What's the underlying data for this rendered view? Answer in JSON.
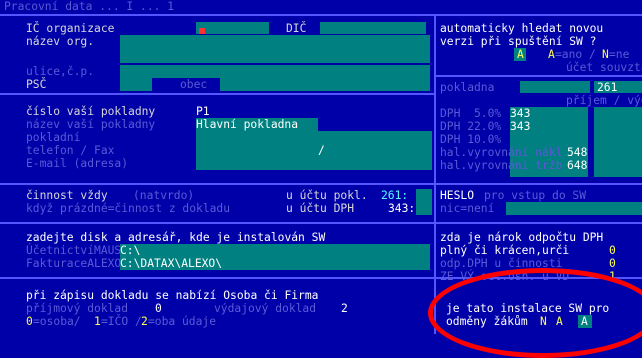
{
  "header": {
    "text": "Pracovní data ... I ... 1"
  },
  "org": {
    "ico_label": "IČ organizace",
    "dic_label": "DIČ",
    "name_label": "název org.",
    "street_label": "ulice,č.p.",
    "psc_label": "PSČ",
    "obec_label": "obec"
  },
  "register": {
    "number_label": "číslo vaší pokladny",
    "number_value": "P1",
    "name_label": "název vaší pokladny",
    "name_value": "Hlavní pokladna",
    "pokladni_label": "pokladní",
    "phone_label": "telefon / Fax",
    "phone_sep": "/",
    "email_label": "E-mail (adresa)"
  },
  "activity": {
    "line1_label": "činnost vždy",
    "line1_hint": "(natvrdo)",
    "line1_account_label": "u účtu pokl.",
    "line1_account_value": "261:",
    "line2_label": "když prázdné=činnost z dokladu",
    "line2_account_label": "u účtu DPH",
    "line2_account_value": "343:"
  },
  "disk": {
    "title": "zadejte disk a adresář, kde je instalován SW",
    "ucetnictvi_label": "ÚčetnictvíMAUS",
    "ucetnictvi_value": "C:\\",
    "fakturace_label": "FakturaceALEXO",
    "fakturace_value": "C:\\DATAX\\ALEXO\\"
  },
  "person": {
    "title": "při zápisu dokladu se nabízí Osoba či Firma",
    "prijmovy_label": "příjmový doklad",
    "prijmovy_value": "0",
    "vydajovy_label": "výdajový doklad",
    "vydajovy_value": "2",
    "legend_0": "0",
    "legend_0_text": "=osoba/",
    "legend_1": "1",
    "legend_1_text": "=IČO /",
    "legend_2": "2",
    "legend_2_text": "=oba údaje"
  },
  "right": {
    "auto_line1": "automaticky hledat novou",
    "auto_line2": "verzi při spuštění SW ?",
    "auto_value": "A",
    "auto_hint_key": "A",
    "auto_hint": "=ano /",
    "auto_hint_n": "N",
    "auto_hint_tail": "=ne",
    "ucet_header": "účet souvztaž",
    "prijem_header": "příjem / výdej",
    "pokladna_label": "pokladna",
    "pokladna_value": "261",
    "dph5_label": "DPH  5.0%",
    "dph5_value": "343",
    "dph22_label": "DPH 22.0%",
    "dph22_value": "343",
    "dph10_label": "DPH 10.0%",
    "hal_nakl_label": "hal.vyrovnání nákl",
    "hal_nakl_value": "548",
    "hal_trzb_label": "hal.vyrovnání tržb",
    "hal_trzb_value": "648",
    "heslo_label": "HESLO",
    "heslo_hint": "pro vstup do SW",
    "heslo_none": "nic=není",
    "narok_line1": "zda je nárok odpočtu DPH",
    "narok_line2_a": "plný či krácen,urči",
    "narok_line2_v": "0",
    "narok_line3_a": "odp.DPH u činnosti",
    "narok_line3_v": "0",
    "narok_line4_a": "ZE VÝ oct.osn. u VD",
    "narok_line4_v": "1",
    "install_line1": "je tato instalace SW pro",
    "install_line2": "odměny žákům",
    "install_n": "N",
    "install_a": "A",
    "install_value": "A"
  },
  "colors": {
    "background": "#0000a8",
    "field": "#008080",
    "highlight": "#ff0000"
  }
}
